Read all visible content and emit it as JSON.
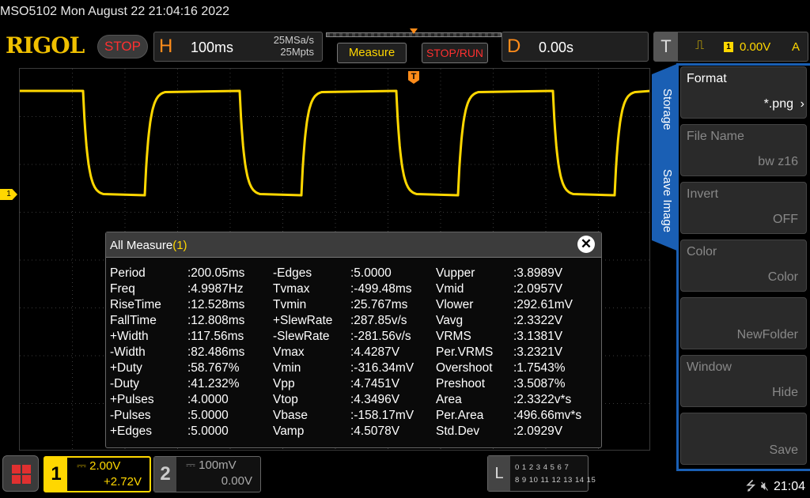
{
  "window": {
    "title": "MSO5102  Mon August 22 21:04:16 2022"
  },
  "header": {
    "logo": "RIGOL",
    "run_state": "STOP",
    "horizontal": {
      "letter": "H",
      "timebase": "100ms",
      "sample_rate": "25MSa/s",
      "memory_depth": "25Mpts"
    },
    "measure_label": "Measure",
    "stop_run_label": "STOP/RUN",
    "delay": {
      "letter": "D",
      "value": "0.00s"
    },
    "trigger": {
      "letter": "T",
      "source": "1",
      "level": "0.00V",
      "mode": "A"
    }
  },
  "scope": {
    "channel_marker": "1",
    "trigger_marker": "T"
  },
  "measure_panel": {
    "title": "All Measure",
    "channel": "(1)",
    "close_label": "✕",
    "columns": [
      {
        "names": [
          "Period",
          "Freq",
          "RiseTime",
          "FallTime",
          "+Width",
          "-Width",
          "+Duty",
          "-Duty",
          "+Pulses",
          "-Pulses",
          "+Edges"
        ],
        "values": [
          ":200.05ms",
          ":4.9987Hz",
          ":12.528ms",
          ":12.808ms",
          ":117.56ms",
          ":82.486ms",
          ":58.767%",
          ":41.232%",
          ":4.0000",
          ":5.0000",
          ":5.0000"
        ]
      },
      {
        "names": [
          "-Edges",
          "Tvmax",
          "Tvmin",
          "+SlewRate",
          "-SlewRate",
          "Vmax",
          "Vmin",
          "Vpp",
          "Vtop",
          "Vbase",
          "Vamp"
        ],
        "values": [
          ":5.0000",
          ":-499.48ms",
          ":25.767ms",
          ":287.85v/s",
          ":-281.56v/s",
          ":4.4287V",
          ":-316.34mV",
          ":4.7451V",
          ":4.3496V",
          ":-158.17mV",
          ":4.5078V"
        ]
      },
      {
        "names": [
          "Vupper",
          "Vmid",
          "Vlower",
          "Vavg",
          "VRMS",
          "Per.VRMS",
          "Overshoot",
          "Preshoot",
          "Area",
          "Per.Area",
          "Std.Dev"
        ],
        "values": [
          ":3.8989V",
          ":2.0957V",
          ":292.61mV",
          ":2.3322V",
          ":3.1381V",
          ":3.2321V",
          ":1.7543%",
          ":3.5087%",
          ":2.3322v*s",
          ":496.66mv*s",
          ":2.0929V"
        ]
      }
    ]
  },
  "side_menu": {
    "tabs": [
      "Storage",
      "Save Image"
    ],
    "items": [
      {
        "title": "Format",
        "value": "*.png",
        "enabled": true
      },
      {
        "title": "File Name",
        "value": "bw z16",
        "enabled": false
      },
      {
        "title": "Invert",
        "value": "OFF",
        "enabled": false
      },
      {
        "title": "Color",
        "value": "Color",
        "enabled": false
      },
      {
        "title": "",
        "value": "NewFolder",
        "enabled": false
      },
      {
        "title": "Window",
        "value": "Hide",
        "enabled": false
      },
      {
        "title": "",
        "value": "Save",
        "enabled": false
      }
    ]
  },
  "bottom": {
    "ch1": {
      "num": "1",
      "scale": "2.00V",
      "offset": "+2.72V"
    },
    "ch2": {
      "num": "2",
      "scale": "100mV",
      "offset": "0.00V"
    },
    "digital": {
      "letter": "L",
      "row1": "0 1 2 3  4 5 6 7",
      "row2": "8 9 10 11 12 13 14 15"
    },
    "clock": "21:04"
  },
  "colors": {
    "ch1": "#ffd700",
    "accent": "#ff8c1a",
    "stop": "#ff3030",
    "menu_blue": "#1a5fb4",
    "grid": "#3a3a3a"
  }
}
